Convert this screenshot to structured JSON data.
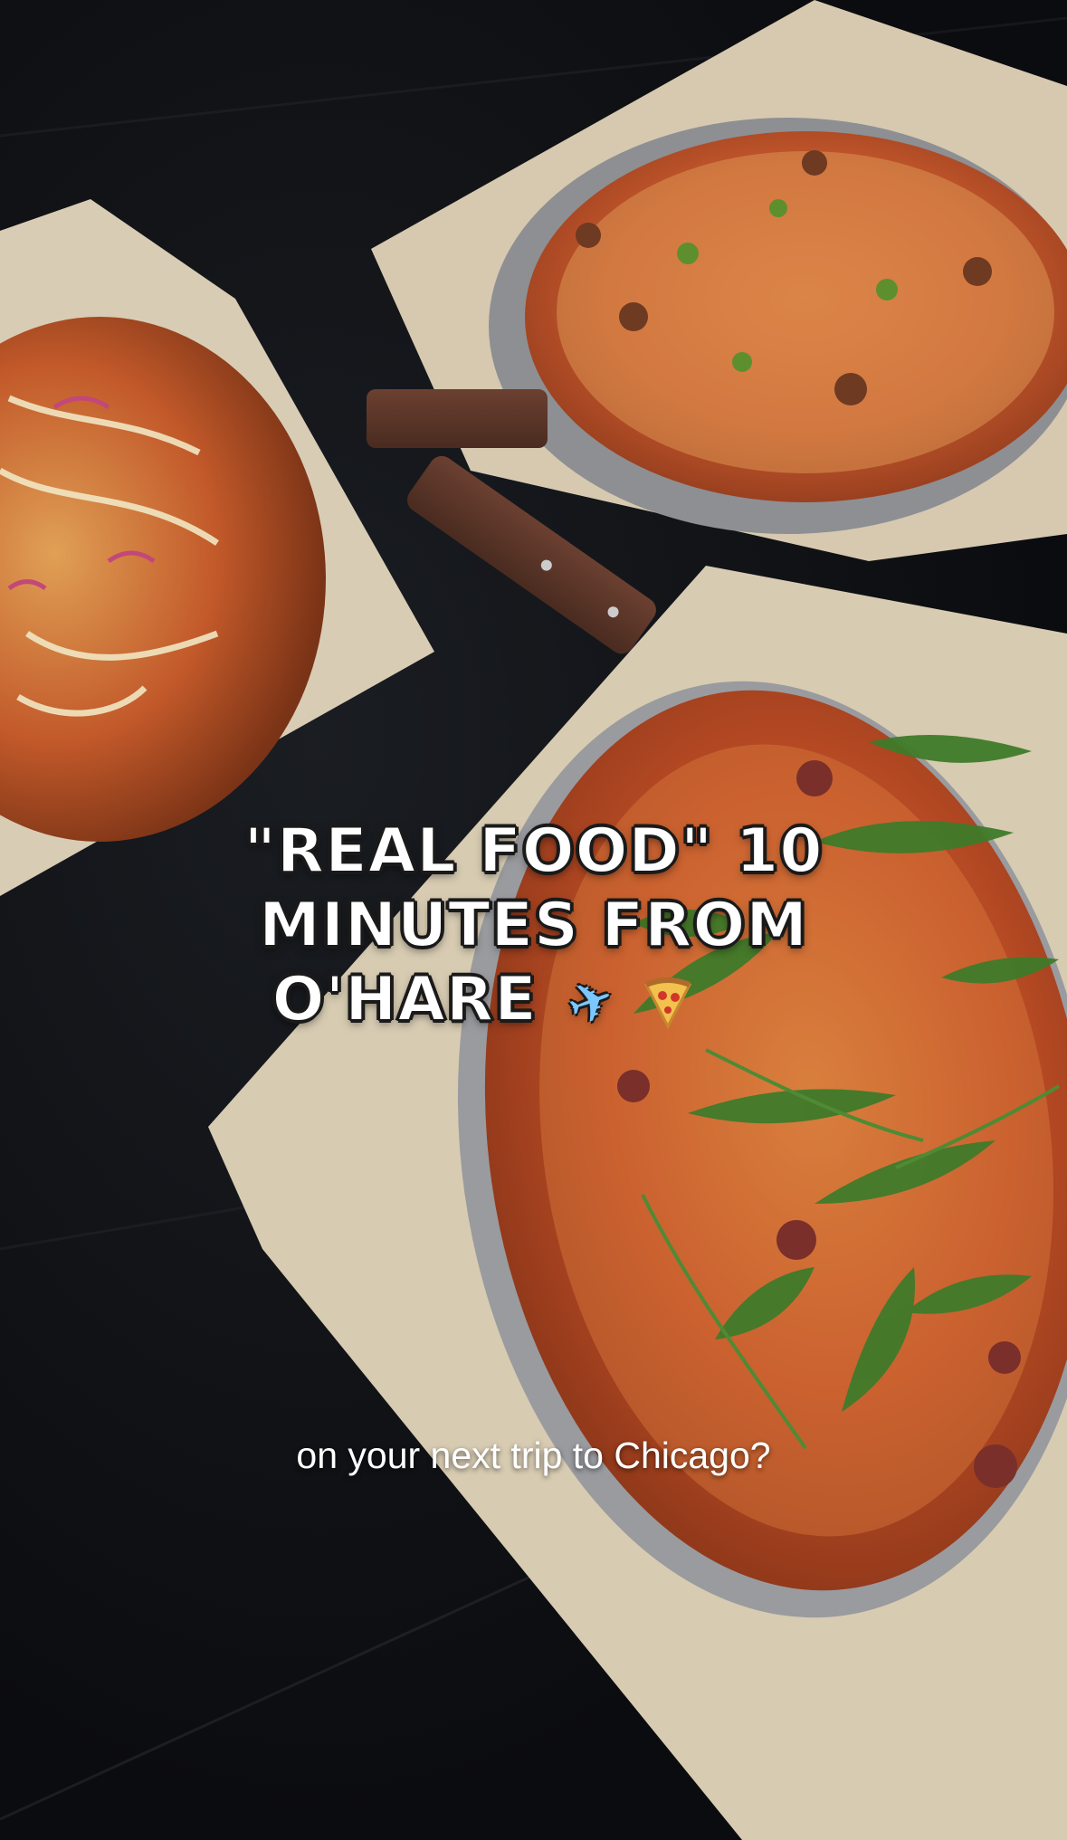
{
  "overlay": {
    "headline_line1": "\"REAL FOOD\" 10",
    "headline_line2": "MINUTES FROM",
    "headline_line3": "O'HARE",
    "caption": "on your next trip to Chicago?"
  },
  "icons": {
    "plane": "airplane-emoji",
    "pizza": "pizza-emoji"
  },
  "colors": {
    "table": "#0d0f12",
    "paper": "#d9cdb6",
    "crust": "#c98a45",
    "sauce": "#c0392b",
    "arugula": "#3f7a2a"
  }
}
